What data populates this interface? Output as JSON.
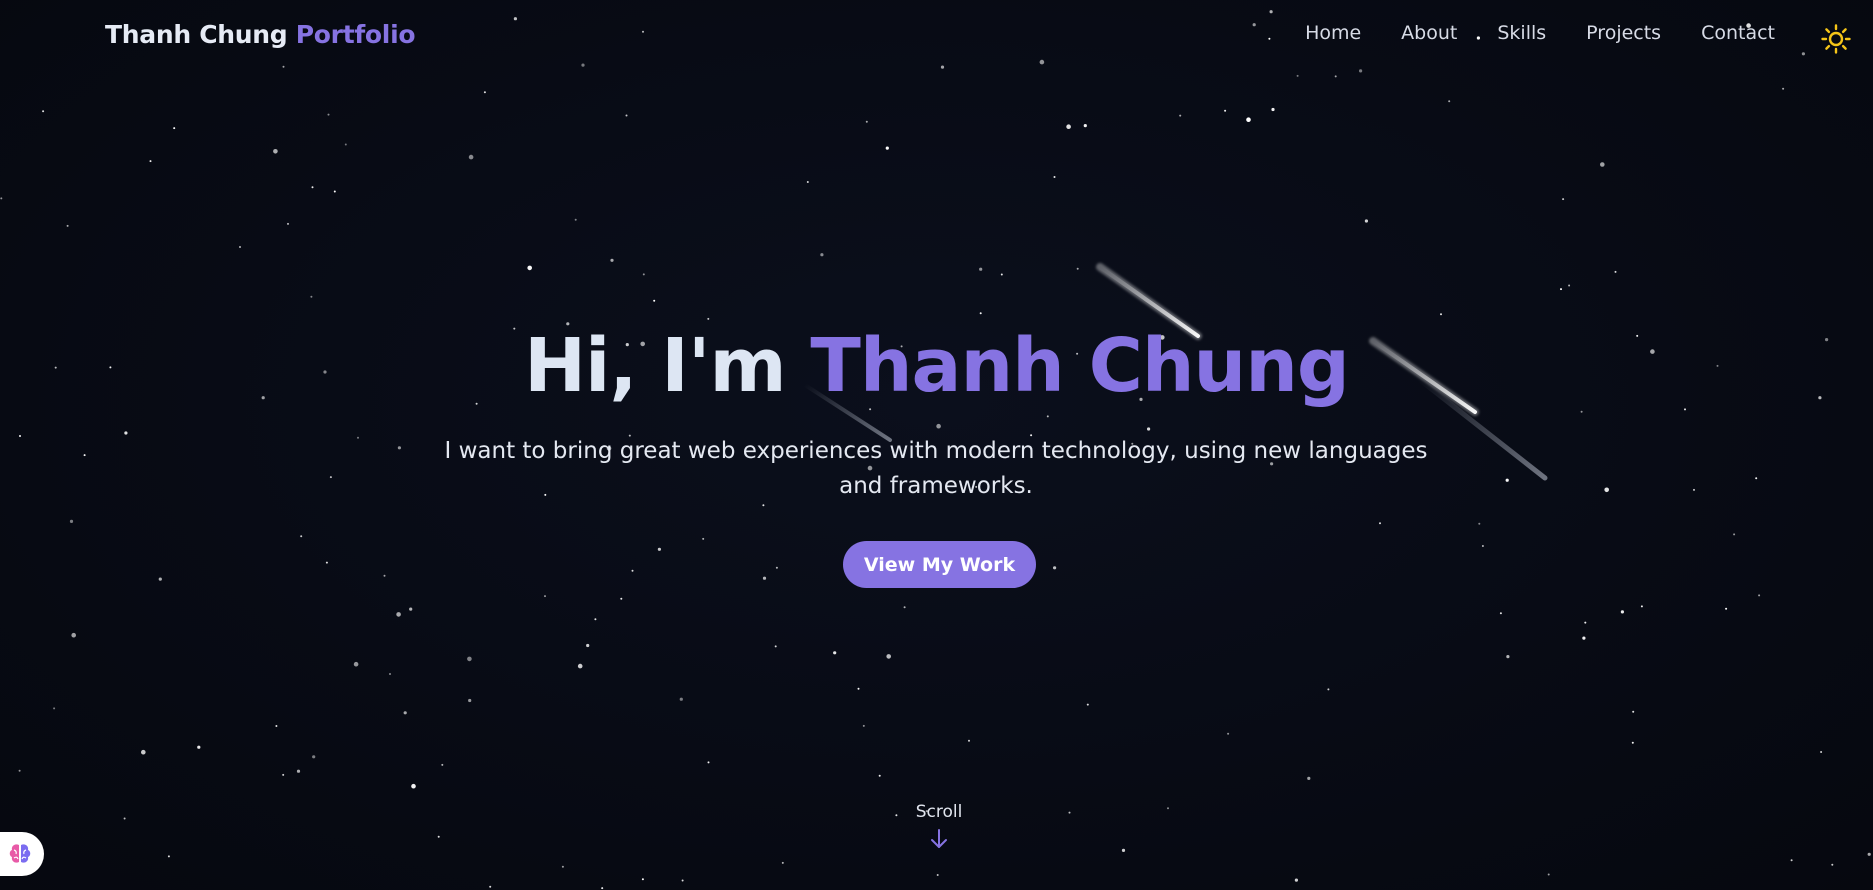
{
  "brand": {
    "name": "Thanh Chung",
    "accent": "Portfolio"
  },
  "nav": {
    "items": [
      {
        "label": "Home"
      },
      {
        "label": "About"
      },
      {
        "label": "Skills"
      },
      {
        "label": "Projects"
      },
      {
        "label": "Contact"
      }
    ],
    "theme_toggle_icon": "sun-icon"
  },
  "hero": {
    "greeting": "Hi, I'm ",
    "name": "Thanh Chung",
    "subtitle": "I want to bring great web experiences with modern technology, using new languages and frameworks.",
    "cta_label": "View My Work"
  },
  "scroll": {
    "label": "Scroll",
    "icon": "arrow-down-icon"
  },
  "assistant_badge": {
    "icon": "brain-icon"
  },
  "colors": {
    "background": "#070a13",
    "accent": "#8673e2",
    "text": "#dde6f3",
    "sun": "#f5c518"
  }
}
